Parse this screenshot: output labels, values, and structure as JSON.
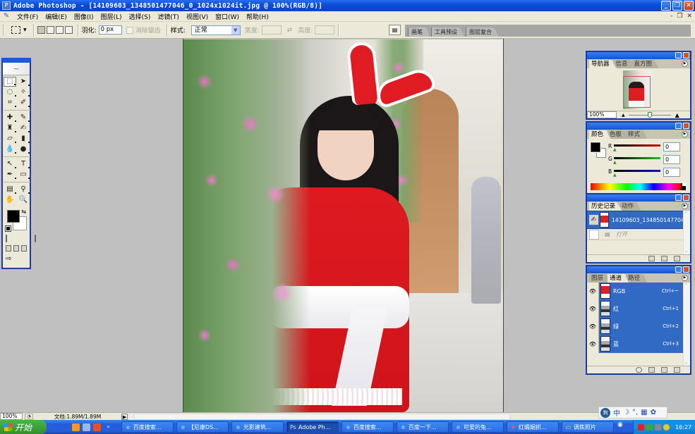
{
  "window": {
    "title": "Adobe Photoshop - [14109603_1348501477046_0_1024x1024it.jpg @ 100%(RGB/8)]",
    "buttons": {
      "minimize": "_",
      "restore": "❐",
      "close": "✕"
    }
  },
  "menubar": {
    "items": [
      "文件(F)",
      "编辑(E)",
      "图像(I)",
      "图层(L)",
      "选择(S)",
      "滤镜(T)",
      "视图(V)",
      "窗口(W)",
      "帮助(H)"
    ],
    "mdi_buttons": {
      "minimize": "-",
      "restore": "❐",
      "close": "✕"
    }
  },
  "options_bar": {
    "feather_label": "羽化:",
    "feather_value": "0 px",
    "antialias_label": "消除锯齿",
    "style_label": "样式:",
    "style_value": "正常",
    "width_label": "宽度:",
    "width_value": "",
    "height_label": "高度:",
    "height_value": "",
    "swap_icon": "⇄"
  },
  "palette_well": {
    "tabs": [
      "画笔",
      "工具预设",
      "图层复合"
    ]
  },
  "navigator": {
    "tabs": [
      "导航器",
      "信息",
      "直方图"
    ],
    "zoom_value": "100%",
    "zoom_slider_fraction": 0.5
  },
  "color_panel": {
    "tabs": [
      "颜色",
      "色板",
      "样式"
    ],
    "foreground": "#000000",
    "background": "#ffffff",
    "channels": [
      {
        "label": "R",
        "value": "0",
        "ramp_color": "#d01010"
      },
      {
        "label": "G",
        "value": "0",
        "ramp_color": "#20c020"
      },
      {
        "label": "B",
        "value": "0",
        "ramp_color": "#1010c0"
      }
    ]
  },
  "history_panel": {
    "tabs": [
      "历史记录",
      "动作"
    ],
    "snapshot_label": "14109603_134850147704...",
    "steps": [
      "打开"
    ]
  },
  "channels_panel": {
    "tabs": [
      "图层",
      "通道",
      "路径"
    ],
    "channels": [
      {
        "name": "RGB",
        "shortcut": "Ctrl+~"
      },
      {
        "name": "红",
        "shortcut": "Ctrl+1"
      },
      {
        "name": "绿",
        "shortcut": "Ctrl+2"
      },
      {
        "name": "蓝",
        "shortcut": "Ctrl+3"
      }
    ]
  },
  "statusbar": {
    "zoom": "100%",
    "doc_size": "文档:1.89M/1.89M",
    "arrow": "▶"
  },
  "ime_bar": {
    "logo": "狗",
    "mode": "中",
    "moon": "☽",
    "punct": "°,",
    "keyboard": "▦",
    "settings": "✿"
  },
  "taskbar": {
    "start_label": "开始",
    "quick_more": "»",
    "tasks": [
      {
        "label": "百度搜索...",
        "icon": "e",
        "active": false
      },
      {
        "label": "【尼康DS...",
        "icon": "e",
        "active": false
      },
      {
        "label": "光影建筑...",
        "icon": "e",
        "active": false
      },
      {
        "label": "Adobe Ph...",
        "icon": "Ps",
        "active": true
      },
      {
        "label": "百度搜索...",
        "icon": "e",
        "active": false
      },
      {
        "label": "百度一下...",
        "icon": "e",
        "active": false
      },
      {
        "label": "可爱的兔...",
        "icon": "e",
        "active": false
      },
      {
        "label": "红孀姻抓...",
        "icon": "✚",
        "active": false
      },
      {
        "label": "调焦照片",
        "icon": "▭",
        "active": false
      }
    ],
    "clock": "16:27"
  }
}
